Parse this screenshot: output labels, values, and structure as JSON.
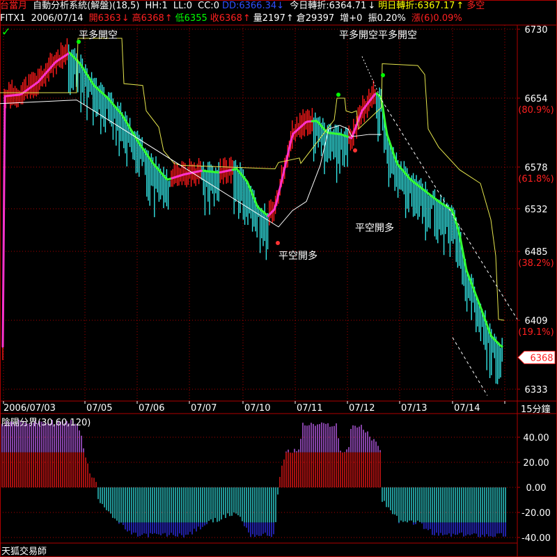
{
  "header": {
    "app_name": "台當月",
    "system_title": "自動分析系統(解盤)(18,5)",
    "hh": "HH:1",
    "ll": "LL:0",
    "cc": "CC:0",
    "dd": "DD:6366.34",
    "dd_arrow": "↓",
    "today_turn": "今日轉折:6364.71",
    "today_arrow": "↓",
    "tomorrow_turn": "明日轉折:6367.17",
    "tomorrow_arrow": "↑",
    "direction": "多空"
  },
  "quote": {
    "symbol": "FITX1",
    "date": "2006/07/14",
    "open_label": "開6363",
    "open_arrow": "↓",
    "high_label": "高6368",
    "high_arrow": "↑",
    "low_label": "低6355",
    "close_label": "收6368",
    "close_arrow": "↑",
    "volume": "量2197",
    "vol_arrow": "↑",
    "oi": "倉29397",
    "change": "增+0",
    "amplitude": "振0.20%",
    "rise": "漲(6)0.09%"
  },
  "price_axis": {
    "ticks": [
      "6730",
      "6654",
      "6578",
      "6532",
      "6485",
      "6409",
      "6333"
    ],
    "fib_labels": [
      "(80.9%)",
      "(61.8%)",
      "(38.2%)",
      "(19.1%)"
    ],
    "current_price": "6368"
  },
  "time_axis": {
    "labels": [
      "2006/07/03",
      "07/05",
      "07/06",
      "07/07",
      "07/10",
      "07/11",
      "07/12",
      "07/13",
      "07/14"
    ],
    "timeframe": "15分鐘"
  },
  "signals": [
    {
      "text": "平多開空"
    },
    {
      "text": "平空開多"
    },
    {
      "text": "平多開空平多開空"
    },
    {
      "text": "平空開多"
    }
  ],
  "indicator": {
    "title": "陰陽分界(30,60,120)",
    "ticks": [
      "40.00",
      "20.00",
      "0.00",
      "-20.00",
      "-40.00"
    ]
  },
  "footer": {
    "brand": "天狐交易師"
  },
  "colors": {
    "up_bar": "#ff1a1a",
    "down_bar": "#33e6e6",
    "ma_up": "#ff33cc",
    "ma_down": "#33ff33",
    "stop_line": "#e6e64d",
    "ind_purple": "#cc66ff",
    "ind_blue": "#3333ff",
    "grid": "#b00000"
  }
}
